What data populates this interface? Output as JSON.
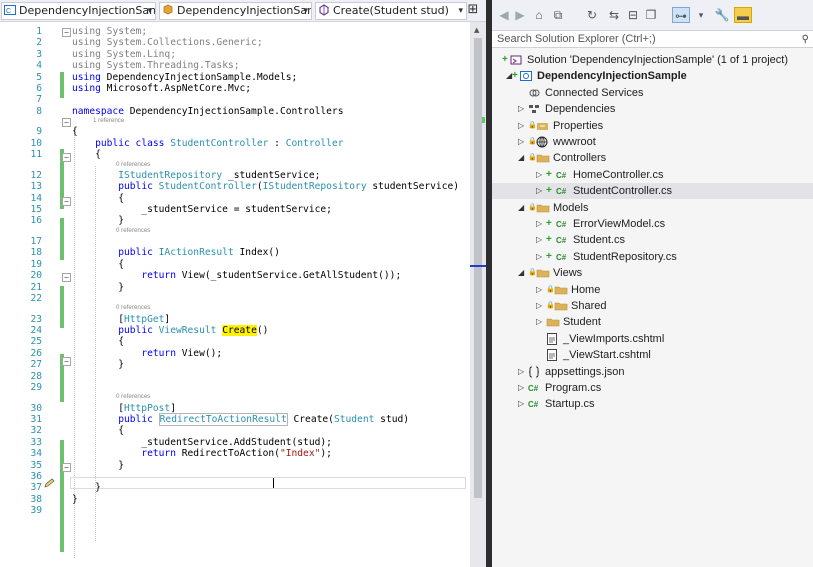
{
  "editor": {
    "nav": {
      "project": "DependencyInjectionSan",
      "class": "DependencyInjectionSan",
      "member": "Create(Student stud)"
    },
    "lines": [
      {
        "n": "1",
        "t": [
          [
            "kw",
            "using"
          ],
          [
            "",
            "System;"
          ]
        ],
        "dim": true
      },
      {
        "n": "2",
        "t": [
          [
            "kw",
            "using"
          ],
          [
            "",
            "System.Collections.Generic;"
          ]
        ],
        "dim": true
      },
      {
        "n": "3",
        "t": [
          [
            "kw",
            "using"
          ],
          [
            "",
            "System.Linq;"
          ]
        ],
        "dim": true
      },
      {
        "n": "4",
        "t": [
          [
            "kw",
            "using"
          ],
          [
            "",
            "System.Threading.Tasks;"
          ]
        ],
        "dim": true
      },
      {
        "n": "5",
        "t": [
          [
            "kw",
            "using"
          ],
          [
            "",
            "DependencyInjectionSample.Models;"
          ]
        ]
      },
      {
        "n": "6",
        "t": [
          [
            "kw",
            "using"
          ],
          [
            "",
            "Microsoft.AspNetCore.Mvc;"
          ]
        ]
      },
      {
        "n": "7",
        "t": []
      },
      {
        "n": "8",
        "t": [
          [
            "kw",
            "namespace"
          ],
          [
            "",
            "DependencyInjectionSample.Controllers"
          ]
        ]
      },
      {
        "n": "9",
        "t": [
          [
            "",
            "{"
          ]
        ]
      },
      {
        "n": "10",
        "t": [
          [
            "",
            "    "
          ],
          [
            "kw",
            "public class"
          ],
          [
            "ty",
            "StudentController"
          ],
          [
            "",
            " : "
          ],
          [
            "ty",
            "Controller"
          ]
        ]
      },
      {
        "n": "11",
        "t": [
          [
            "",
            "    {"
          ]
        ]
      },
      {
        "n": "12",
        "t": [
          [
            "",
            "        "
          ],
          [
            "ty",
            "IStudentRepository"
          ],
          [
            "",
            " _studentService;"
          ]
        ]
      },
      {
        "n": "13",
        "t": [
          [
            "",
            "        "
          ],
          [
            "kw",
            "public"
          ],
          [
            "ty",
            "StudentController"
          ],
          [
            "",
            "("
          ],
          [
            "ty",
            "IStudentRepository"
          ],
          [
            "",
            " studentService)"
          ]
        ]
      },
      {
        "n": "14",
        "t": [
          [
            "",
            "        {"
          ]
        ]
      },
      {
        "n": "15",
        "t": [
          [
            "",
            "            _studentService = studentService;"
          ]
        ]
      },
      {
        "n": "16",
        "t": [
          [
            "",
            "        }"
          ]
        ]
      },
      {
        "n": "17",
        "t": []
      },
      {
        "n": "18",
        "t": [
          [
            "",
            "        "
          ],
          [
            "kw",
            "public"
          ],
          [
            "ty",
            "IActionResult"
          ],
          [
            "",
            " Index()"
          ]
        ]
      },
      {
        "n": "19",
        "t": [
          [
            "",
            "        {"
          ]
        ]
      },
      {
        "n": "20",
        "t": [
          [
            "",
            "            "
          ],
          [
            "kw",
            "return"
          ],
          [
            "",
            " View(_studentService.GetAllStudent());"
          ]
        ]
      },
      {
        "n": "21",
        "t": [
          [
            "",
            "        }"
          ]
        ]
      },
      {
        "n": "22",
        "t": []
      },
      {
        "n": "23",
        "t": [
          [
            "",
            "        ["
          ],
          [
            "ty",
            "HttpGet"
          ],
          [
            "",
            "]"
          ]
        ]
      },
      {
        "n": "24",
        "t": [
          [
            "",
            "        "
          ],
          [
            "kw",
            "public"
          ],
          [
            "ty",
            "ViewResult"
          ],
          [
            "",
            ""
          ],
          [
            "hl",
            "Create"
          ],
          [
            "",
            "()"
          ]
        ]
      },
      {
        "n": "25",
        "t": [
          [
            "",
            "        {"
          ]
        ]
      },
      {
        "n": "26",
        "t": [
          [
            "",
            "            "
          ],
          [
            "kw",
            "return"
          ],
          [
            "",
            " View();"
          ]
        ]
      },
      {
        "n": "27",
        "t": [
          [
            "",
            "        }"
          ]
        ]
      },
      {
        "n": "28",
        "t": []
      },
      {
        "n": "29",
        "t": []
      },
      {
        "n": "30",
        "t": [
          [
            "",
            "        ["
          ],
          [
            "ty",
            "HttpPost"
          ],
          [
            "",
            "]"
          ]
        ]
      },
      {
        "n": "31",
        "t": [
          [
            "",
            "        "
          ],
          [
            "kw",
            "public"
          ],
          [
            "tybox",
            "RedirectToActionResult"
          ],
          [
            "",
            " Create("
          ],
          [
            "ty",
            "Student"
          ],
          [
            "",
            " stud)"
          ]
        ]
      },
      {
        "n": "32",
        "t": [
          [
            "",
            "        {"
          ]
        ]
      },
      {
        "n": "33",
        "t": [
          [
            "",
            "            _studentService.AddStudent(stud);"
          ]
        ]
      },
      {
        "n": "34",
        "t": [
          [
            "",
            "            "
          ],
          [
            "kw",
            "return"
          ],
          [
            "",
            " RedirectToAction("
          ],
          [
            "st",
            "\"Index\""
          ],
          [
            "",
            ");"
          ]
        ]
      },
      {
        "n": "35",
        "t": [
          [
            "",
            "        }"
          ]
        ]
      },
      {
        "n": "36",
        "t": []
      },
      {
        "n": "37",
        "t": [
          [
            "",
            "    }"
          ]
        ]
      },
      {
        "n": "38",
        "t": [
          [
            "",
            "}"
          ]
        ]
      },
      {
        "n": "39",
        "t": []
      }
    ],
    "refs": [
      {
        "after": "9",
        "text": "1 reference"
      },
      {
        "after": "12",
        "text": "0 references"
      },
      {
        "after": "17",
        "text": "0 references"
      },
      {
        "after": "23",
        "text": "0 references"
      },
      {
        "after": "30",
        "text": "0 references"
      }
    ]
  },
  "solution_explorer": {
    "search_placeholder": "Search Solution Explorer (Ctrl+;)",
    "tree": [
      {
        "label": "Solution 'DependencyInjectionSample' (1 of 1 project)",
        "icon": "solution-icon",
        "depth": 0,
        "exp": ""
      },
      {
        "label": "DependencyInjectionSample",
        "icon": "project-icon",
        "depth": 1,
        "exp": "open",
        "bold": true
      },
      {
        "label": "Connected Services",
        "icon": "connected-services-icon",
        "depth": 2,
        "exp": ""
      },
      {
        "label": "Dependencies",
        "icon": "dependencies-icon",
        "depth": 2,
        "exp": "closed"
      },
      {
        "label": "Properties",
        "icon": "properties-icon",
        "depth": 2,
        "exp": "closed"
      },
      {
        "label": "wwwroot",
        "icon": "globe-icon",
        "depth": 2,
        "exp": "closed"
      },
      {
        "label": "Controllers",
        "icon": "folder-icon",
        "depth": 2,
        "exp": "open"
      },
      {
        "label": "HomeController.cs",
        "icon": "csharp-file-icon",
        "depth": 3,
        "exp": "closed"
      },
      {
        "label": "StudentController.cs",
        "icon": "csharp-file-icon",
        "depth": 3,
        "exp": "closed",
        "selected": true
      },
      {
        "label": "Models",
        "icon": "folder-icon",
        "depth": 2,
        "exp": "open"
      },
      {
        "label": "ErrorViewModel.cs",
        "icon": "csharp-file-icon",
        "depth": 3,
        "exp": "closed"
      },
      {
        "label": "Student.cs",
        "icon": "csharp-file-icon",
        "depth": 3,
        "exp": "closed"
      },
      {
        "label": "StudentRepository.cs",
        "icon": "csharp-file-icon",
        "depth": 3,
        "exp": "closed"
      },
      {
        "label": "Views",
        "icon": "folder-icon",
        "depth": 2,
        "exp": "open"
      },
      {
        "label": "Home",
        "icon": "folder-icon",
        "depth": 3,
        "exp": "closed"
      },
      {
        "label": "Shared",
        "icon": "folder-icon",
        "depth": 3,
        "exp": "closed"
      },
      {
        "label": "Student",
        "icon": "folder-icon",
        "depth": 3,
        "exp": "closed"
      },
      {
        "label": "_ViewImports.cshtml",
        "icon": "razor-file-icon",
        "depth": 3,
        "exp": ""
      },
      {
        "label": "_ViewStart.cshtml",
        "icon": "razor-file-icon",
        "depth": 3,
        "exp": ""
      },
      {
        "label": "appsettings.json",
        "icon": "json-file-icon",
        "depth": 2,
        "exp": "closed"
      },
      {
        "label": "Program.cs",
        "icon": "csharp-file-icon",
        "depth": 2,
        "exp": "closed"
      },
      {
        "label": "Startup.cs",
        "icon": "csharp-file-icon",
        "depth": 2,
        "exp": "closed"
      }
    ]
  },
  "colors": {
    "keyword": "#0000ff",
    "type": "#2b91af",
    "string": "#a31515",
    "line_number": "#2b91af",
    "change_bar": "#6cc26c",
    "highlight": "#fff200",
    "divider": "#2d2d30"
  }
}
